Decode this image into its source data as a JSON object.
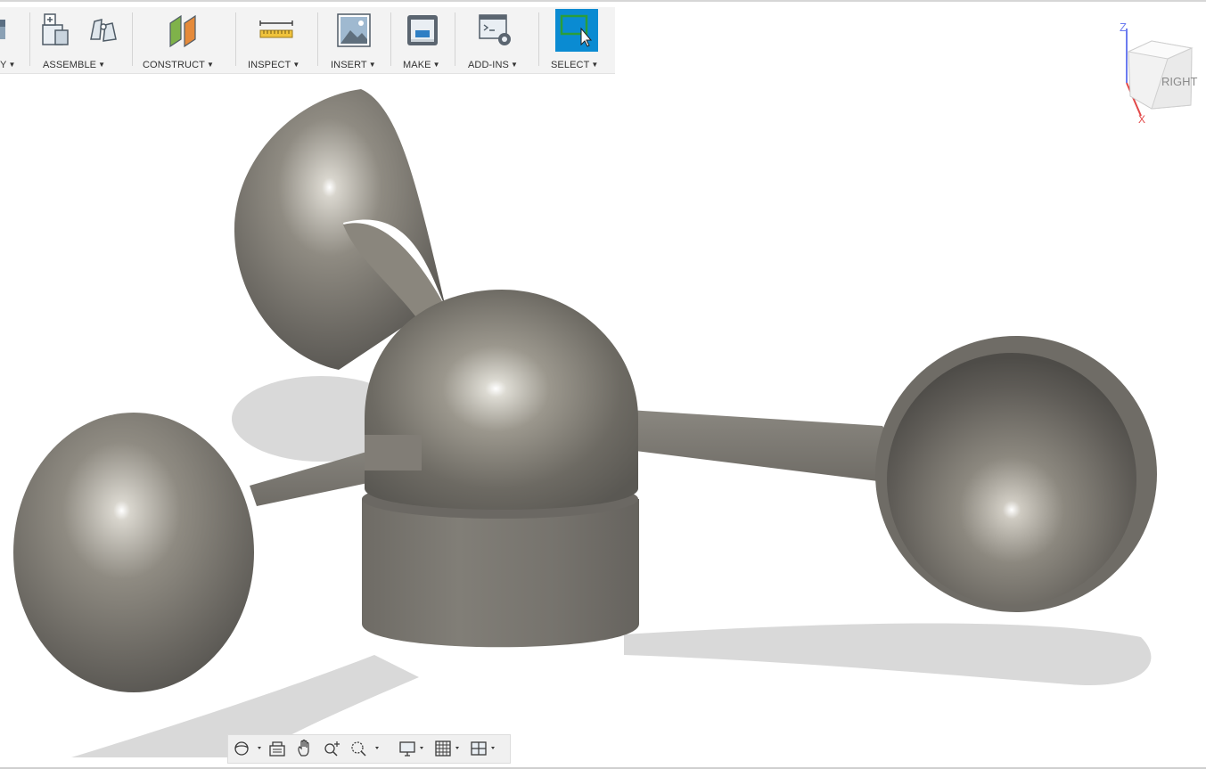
{
  "toolbar": {
    "groups": [
      {
        "label": "Y",
        "icon": "modify-icon"
      },
      {
        "label": "ASSEMBLE",
        "icons": [
          "new-component-icon",
          "joint-icon"
        ]
      },
      {
        "label": "CONSTRUCT",
        "icon": "offset-plane-icon"
      },
      {
        "label": "INSPECT",
        "icon": "measure-icon"
      },
      {
        "label": "INSERT",
        "icon": "insert-image-icon"
      },
      {
        "label": "MAKE",
        "icon": "3d-print-icon"
      },
      {
        "label": "ADD-INS",
        "icon": "scripts-icon"
      },
      {
        "label": "SELECT",
        "icon": "select-window-icon",
        "active": true
      }
    ]
  },
  "viewcube": {
    "face_label": "RIGHT",
    "axis_z": "Z",
    "axis_x": "X"
  },
  "navbar": {
    "items": [
      "orbit-icon",
      "look-at-icon",
      "pan-icon",
      "zoom-icon",
      "zoom-window-icon",
      "display-settings-icon",
      "grid-settings-icon",
      "viewports-icon"
    ]
  },
  "colors": {
    "toolbar_bg": "#f3f3f3",
    "select_active": "#0a8bd2",
    "model": "#7a7770"
  }
}
